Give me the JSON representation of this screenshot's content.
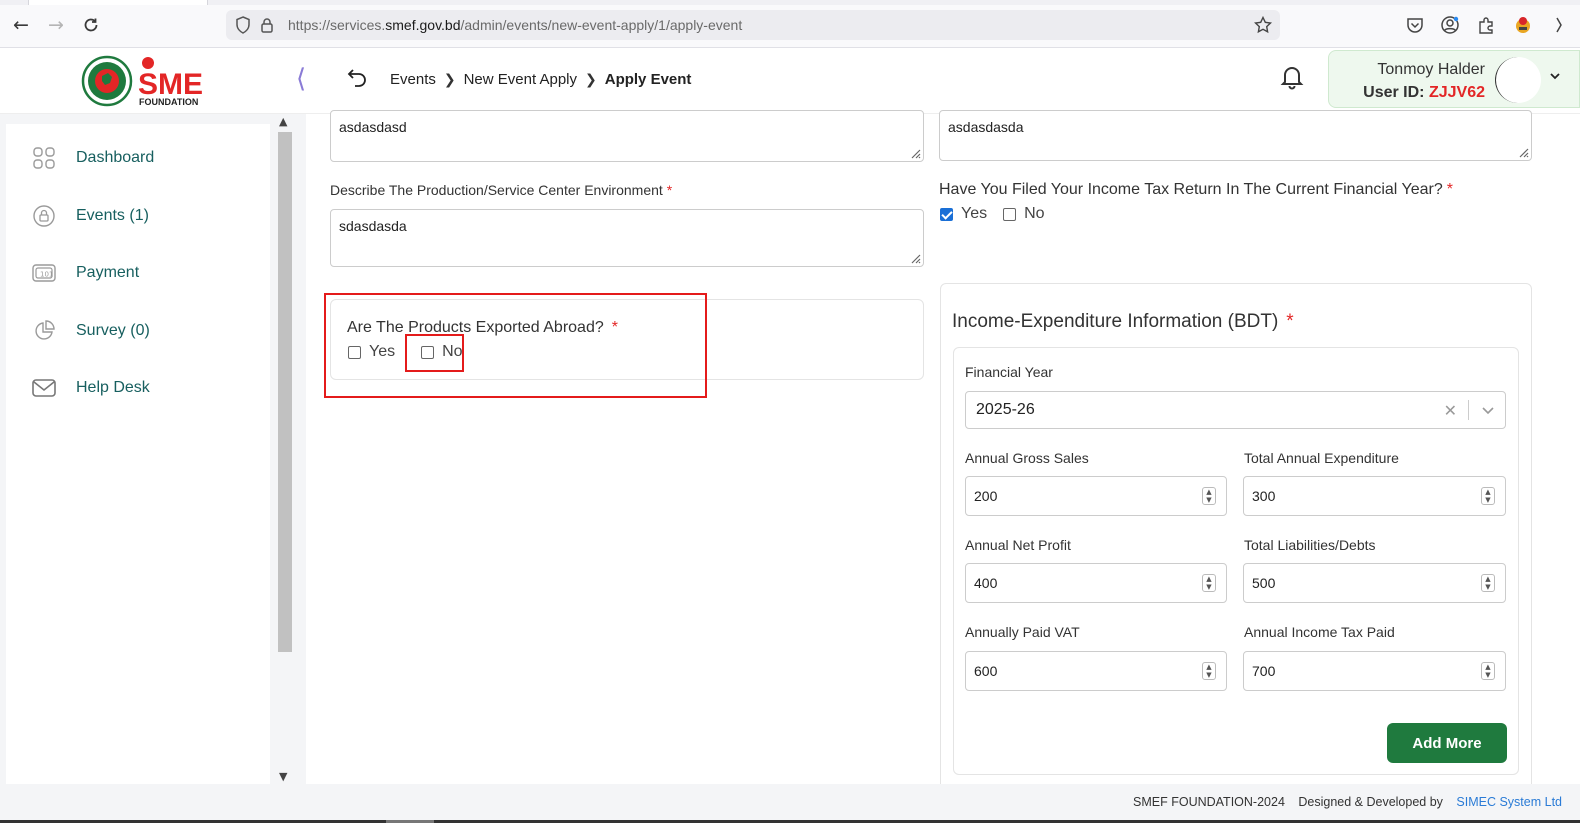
{
  "browser": {
    "url_prefix": "https://services.",
    "url_domain": "smef.gov.bd",
    "url_path": "/admin/events/new-event-apply/1/apply-event"
  },
  "header": {
    "logo_text": "SME",
    "logo_sub": "FOUNDATION",
    "breadcrumbs": [
      "Events",
      "New Event Apply",
      "Apply Event"
    ],
    "user_name": "Tonmoy Halder",
    "user_id_label": "User ID:",
    "user_id": "ZJJV62"
  },
  "sidebar": {
    "items": [
      {
        "label": "Dashboard",
        "icon": "grid-icon"
      },
      {
        "label": "Events (1)",
        "icon": "lock-icon"
      },
      {
        "label": "Payment",
        "icon": "money-icon"
      },
      {
        "label": "Survey (0)",
        "icon": "pie-icon"
      },
      {
        "label": "Help Desk",
        "icon": "mail-icon"
      }
    ]
  },
  "form": {
    "left_top_text": "asdasdasd",
    "right_top_text": "asdasdasda",
    "environment_label": "Describe The Production/Service Center Environment",
    "environment_value": "sdasdasda",
    "tax_return_label": "Have You Filed Your Income Tax Return In The Current Financial Year?",
    "tax_yes": "Yes",
    "tax_no": "No",
    "export_label": "Are The Products Exported Abroad?",
    "export_yes": "Yes",
    "export_no": "No",
    "required_mark": "*"
  },
  "income": {
    "title": "Income-Expenditure Information (BDT)",
    "financial_year_label": "Financial Year",
    "financial_year_value": "2025-26",
    "fields": [
      {
        "label": "Annual Gross Sales",
        "value": "200"
      },
      {
        "label": "Total Annual Expenditure",
        "value": "300"
      },
      {
        "label": "Annual Net Profit",
        "value": "400"
      },
      {
        "label": "Total Liabilities/Debts",
        "value": "500"
      },
      {
        "label": "Annually Paid VAT",
        "value": "600"
      },
      {
        "label": "Annual Income Tax Paid",
        "value": "700"
      }
    ],
    "add_more": "Add More"
  },
  "footer": {
    "copyright": "SMEF FOUNDATION-2024",
    "designed": "Designed & Developed by",
    "company": "SIMEC System Ltd"
  }
}
